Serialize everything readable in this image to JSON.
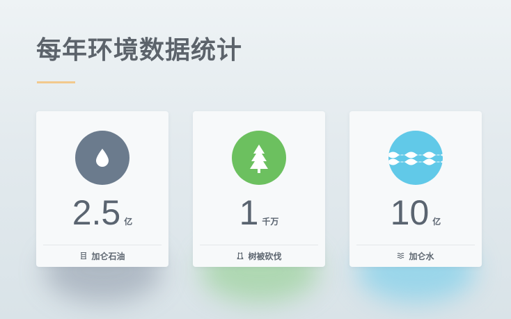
{
  "page": {
    "title": "每年环境数据统计"
  },
  "colors": {
    "title": "#5c636b",
    "underline": "#f2c98d",
    "oil": "#6b7b8d",
    "tree": "#6cc05f",
    "water": "#61c9e8"
  },
  "cards": [
    {
      "icon": "oil-drop-icon",
      "small_icon": "oil-barrel-icon",
      "value": "2.5",
      "unit": "亿",
      "label": "加仑石油"
    },
    {
      "icon": "tree-icon",
      "small_icon": "stump-icon",
      "value": "1",
      "unit": "千万",
      "label": "树被砍伐"
    },
    {
      "icon": "water-waves-icon",
      "small_icon": "waves-icon",
      "value": "10",
      "unit": "亿",
      "label": "加仑水"
    }
  ]
}
